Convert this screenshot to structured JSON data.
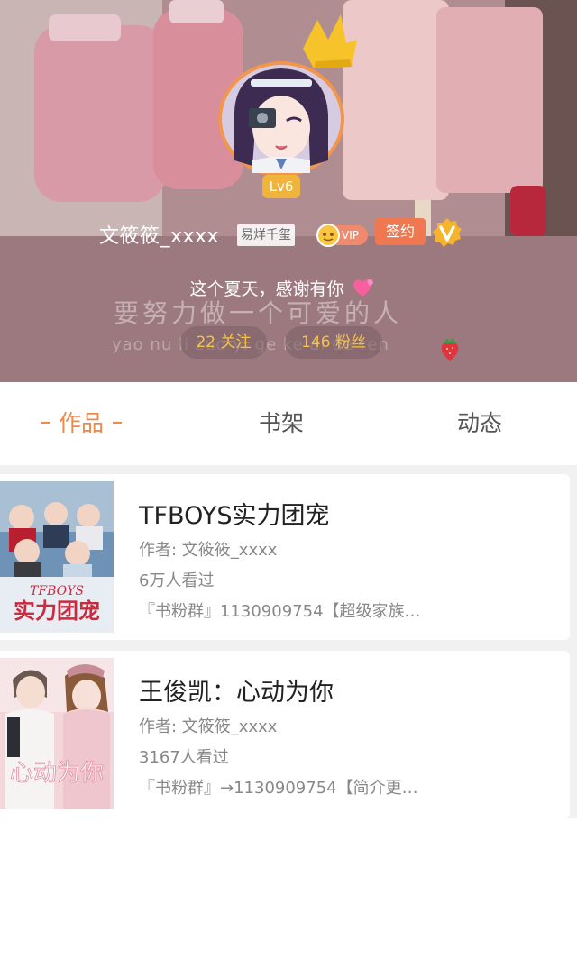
{
  "profile": {
    "level": "Lv6",
    "username": "文筱筱_xxxx",
    "title_tag": "易烊千玺",
    "vip_label": "VIP",
    "contract_label": "签约",
    "bio": "这个夏天，感谢有你",
    "bg_caption": "要努力做一个可爱的人",
    "bg_caption_pinyin": "yao nu li zuo yi ge ke ai de ren",
    "following": "22 关注",
    "fans": "146 粉丝",
    "icons": [
      "crown-icon",
      "vip-coin-icon",
      "verified-v-icon",
      "heart-icon",
      "strawberry-icon"
    ]
  },
  "tabs": [
    {
      "label": "作品",
      "active": true
    },
    {
      "label": "书架",
      "active": false
    },
    {
      "label": "动态",
      "active": false
    }
  ],
  "books": [
    {
      "title": "TFBOYS实力团宠",
      "author": "作者: 文筱筱_xxxx",
      "views": "6万人看过",
      "desc": "『书粉群』1130909754【超级家族…",
      "cover_text": "TFBOYS 实力团宠"
    },
    {
      "title": "王俊凯：心动为你",
      "author": "作者: 文筱筱_xxxx",
      "views": "3167人看过",
      "desc": "『书粉群』→1130909754【简介更…",
      "cover_text": "心动为你"
    }
  ],
  "colors": {
    "accent": "#ec8a4c",
    "stat_text": "#f6c24a",
    "level_badge": "#f0b43c",
    "contract_badge": "#ef7850",
    "header_tint": "#9d7a7f"
  }
}
